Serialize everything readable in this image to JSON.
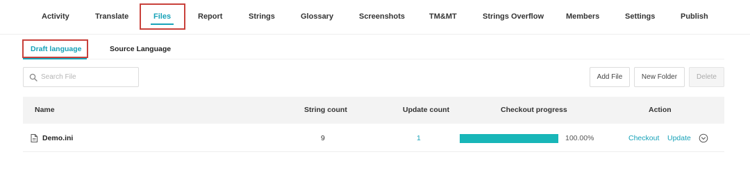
{
  "top_tabs": [
    {
      "label": "Activity"
    },
    {
      "label": "Translate"
    },
    {
      "label": "Files"
    },
    {
      "label": "Report"
    },
    {
      "label": "Strings"
    },
    {
      "label": "Glossary"
    },
    {
      "label": "Screenshots"
    },
    {
      "label": "TM&MT"
    },
    {
      "label": "Strings Overflow"
    },
    {
      "label": "Members"
    },
    {
      "label": "Settings"
    },
    {
      "label": "Publish"
    }
  ],
  "active_top_tab": "Files",
  "sub_tabs": [
    {
      "label": "Draft language"
    },
    {
      "label": "Source Language"
    }
  ],
  "active_sub_tab": "Draft language",
  "search": {
    "placeholder": "Search File",
    "value": ""
  },
  "toolbar": {
    "add_file_label": "Add File",
    "new_folder_label": "New Folder",
    "delete_label": "Delete"
  },
  "table": {
    "headers": {
      "name": "Name",
      "string_count": "String count",
      "update_count": "Update count",
      "checkout_progress": "Checkout progress",
      "action": "Action"
    },
    "rows": [
      {
        "name": "Demo.ini",
        "string_count": "9",
        "update_count": "1",
        "progress": 1.0,
        "progress_text": "100.00%",
        "action_checkout": "Checkout",
        "action_update": "Update"
      }
    ]
  },
  "colors": {
    "accent": "#17a2b8",
    "progress": "#18b6b8",
    "highlight_box": "#c8403a"
  },
  "icons": {
    "search": "search-icon",
    "file": "file-icon",
    "more": "chevron-down-circle-icon"
  }
}
